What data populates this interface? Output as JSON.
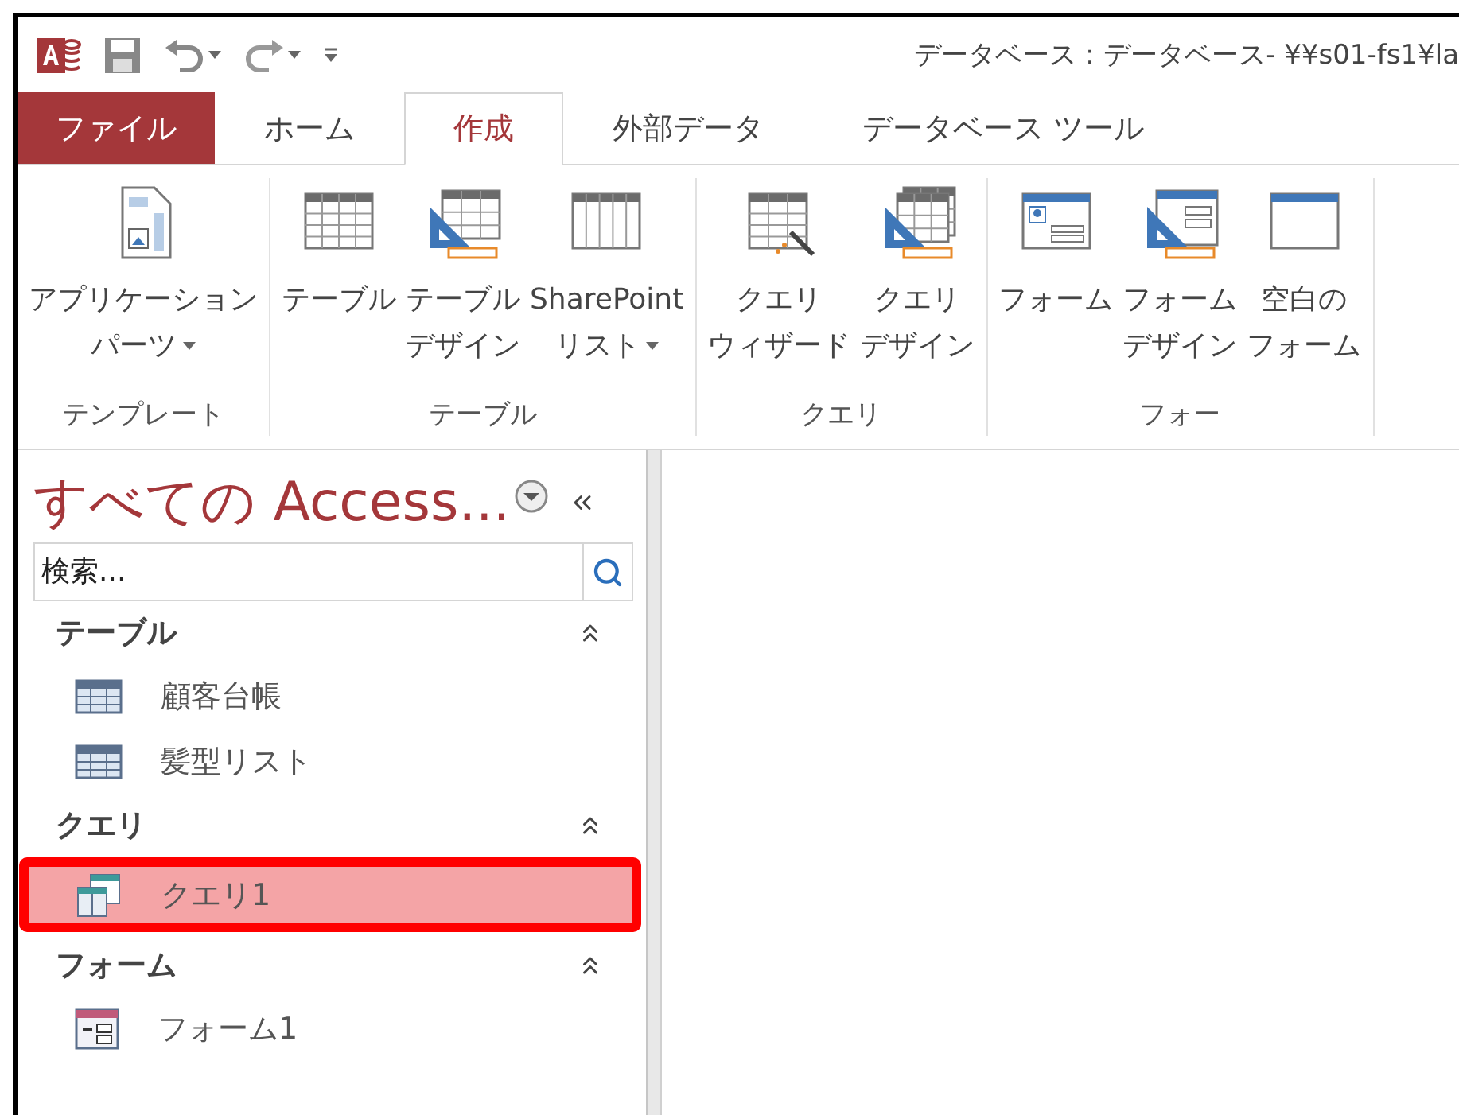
{
  "title_bar": {
    "title": "データベース：データベース- ¥¥s01-fs1¥la"
  },
  "tabs": [
    {
      "label": "ファイル",
      "kind": "file",
      "selected": false
    },
    {
      "label": "ホーム",
      "kind": "tab",
      "selected": false
    },
    {
      "label": "作成",
      "kind": "tab",
      "selected": true
    },
    {
      "label": "外部データ",
      "kind": "tab",
      "selected": false
    },
    {
      "label": "データベース ツール",
      "kind": "tab",
      "selected": false
    }
  ],
  "ribbon": {
    "groups": [
      {
        "label": "テンプレート",
        "buttons": [
          {
            "lines": [
              "アプリケーション",
              "パーツ"
            ],
            "dropdown": true,
            "kind": "app-parts"
          }
        ]
      },
      {
        "label": "テーブル",
        "buttons": [
          {
            "lines": [
              "テーブル"
            ],
            "dropdown": false,
            "kind": "table"
          },
          {
            "lines": [
              "テーブル",
              "デザイン"
            ],
            "dropdown": false,
            "kind": "table-design"
          },
          {
            "lines": [
              "SharePoint",
              "リスト"
            ],
            "dropdown": true,
            "kind": "list"
          }
        ]
      },
      {
        "label": "クエリ",
        "buttons": [
          {
            "lines": [
              "クエリ",
              "ウィザード"
            ],
            "dropdown": false,
            "kind": "query-wizard"
          },
          {
            "lines": [
              "クエリ",
              "デザイン"
            ],
            "dropdown": false,
            "kind": "query-design"
          }
        ]
      },
      {
        "label": "フォー",
        "buttons": [
          {
            "lines": [
              "フォーム"
            ],
            "dropdown": false,
            "kind": "form"
          },
          {
            "lines": [
              "フォーム",
              "デザイン"
            ],
            "dropdown": false,
            "kind": "form-design"
          },
          {
            "lines": [
              "空白の",
              "フォーム"
            ],
            "dropdown": false,
            "kind": "blank-form"
          }
        ]
      }
    ]
  },
  "nav_pane": {
    "title": "すべての Access...",
    "search": {
      "placeholder": "検索..."
    },
    "sections": [
      {
        "label": "テーブル",
        "expanded": true,
        "items": [
          {
            "label": "顧客台帳",
            "kind": "table",
            "selected": false
          },
          {
            "label": "髪型リスト",
            "kind": "table",
            "selected": false
          }
        ]
      },
      {
        "label": "クエリ",
        "expanded": true,
        "items": [
          {
            "label": "クエリ1",
            "kind": "query",
            "selected": true
          }
        ]
      },
      {
        "label": "フォーム",
        "expanded": true,
        "items": [
          {
            "label": "フォーム1",
            "kind": "form",
            "selected": false
          }
        ]
      }
    ]
  }
}
